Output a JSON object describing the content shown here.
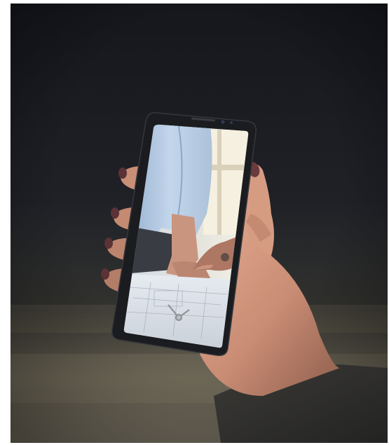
{
  "image": {
    "subject": "hand-holding-smartphone",
    "screen_content": "office-desk-pointing-at-plans",
    "colors": {
      "background_dark": "#1a1c22",
      "background_mid": "#2a2c30",
      "floor_haze": "#6a6558",
      "skin": "#d9a084",
      "skin_shadow": "#9c6a55",
      "nail_polish": "#6a3a3e",
      "phone_body": "#1b1c20",
      "shirt_blue": "#b9cfe6",
      "window_light": "#f4efe2",
      "desk_paper": "#eef1f5"
    }
  }
}
